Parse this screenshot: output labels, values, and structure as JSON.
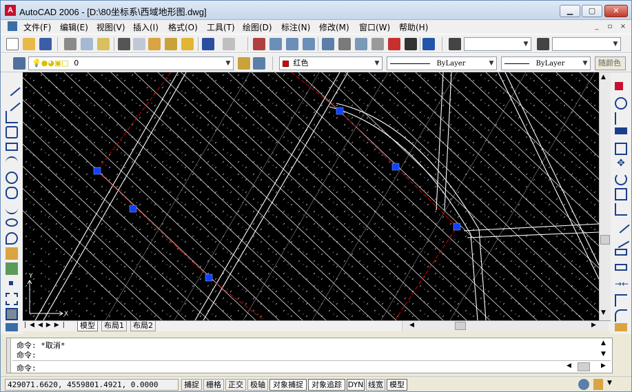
{
  "window": {
    "title": "AutoCAD 2006 - [D:\\80坐标系\\西域地形图.dwg]"
  },
  "menu": [
    "文件(F)",
    "编辑(E)",
    "视图(V)",
    "插入(I)",
    "格式(O)",
    "工具(T)",
    "绘图(D)",
    "标注(N)",
    "修改(M)",
    "窗口(W)",
    "帮助(H)"
  ],
  "layer_toolbar": {
    "layer_value": "0",
    "color_value": "红色",
    "linetype_value": "ByLayer",
    "lineweight_value": "ByLayer",
    "plotstyle_value": "随颜色"
  },
  "colors": {
    "accent_red": "#e00000",
    "grip_blue": "#1040ff",
    "canvas_bg": "#000000"
  },
  "ucs": {
    "x_label": "X",
    "y_label": "Y"
  },
  "layout_tabs": [
    "模型",
    "布局1",
    "布局2"
  ],
  "command": {
    "line1": "命令: *取消*",
    "line2": "命令:",
    "prompt": "命令:"
  },
  "status": {
    "coords": "429071.6620, 4559801.4921, 0.0000",
    "buttons": [
      "捕捉",
      "栅格",
      "正交",
      "极轴",
      "对象捕捉",
      "对象追踪",
      "DYN",
      "线宽",
      "模型"
    ]
  }
}
